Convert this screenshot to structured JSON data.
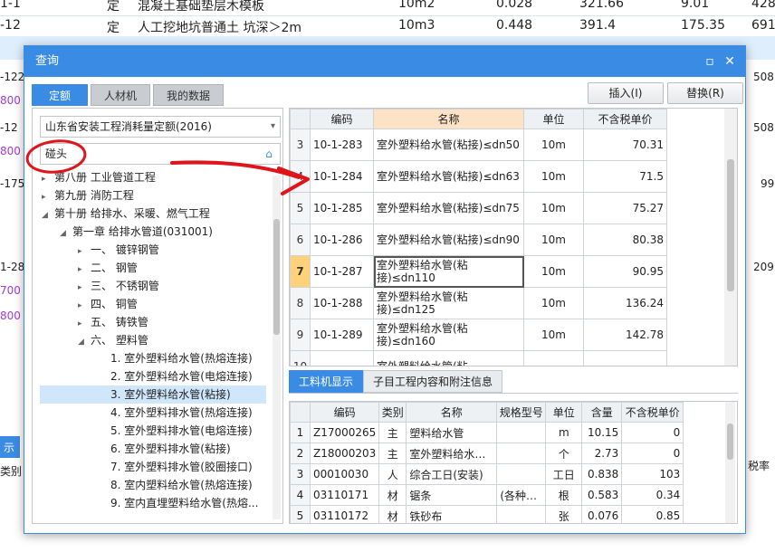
{
  "background": {
    "rows": [
      {
        "c1": "1-1",
        "c2": "定",
        "c3": "混凝土基础垫层木模板",
        "c4": "10m2",
        "c5": "0.028",
        "c6": "321.66",
        "c7": "9.01",
        "c8": "428"
      },
      {
        "c1": "-12",
        "c2": "定",
        "c3": "人工挖地坑普通土 坑深＞2m",
        "c4": "10m3",
        "c5": "0.448",
        "c6": "391.4",
        "c7": "175.35",
        "c8": "691"
      }
    ],
    "side_left": [
      "-122",
      "800",
      "-12",
      "800",
      "-175",
      "1-28",
      "700",
      "800"
    ],
    "side_right": [
      "508",
      "508",
      "99",
      "209"
    ],
    "bottom_left": [
      "示",
      "类别"
    ],
    "bottom_right": "税率"
  },
  "dialog": {
    "title": "查询",
    "tabs": [
      "定额",
      "人材机",
      "我的数据"
    ],
    "insert_button": "插入(I)",
    "replace_button": "替换(R)",
    "library_select": "山东省安装工程消耗量定额(2016)",
    "search_value": "碰头",
    "tree": [
      {
        "label": "第八册 工业管道工程",
        "level": 0,
        "arrow": "▸"
      },
      {
        "label": "第九册 消防工程",
        "level": 0,
        "arrow": "▸"
      },
      {
        "label": "第十册 给排水、采暖、燃气工程",
        "level": 0,
        "arrow": "◢"
      },
      {
        "label": "第一章 给排水管道(031001)",
        "level": 1,
        "arrow": "◢"
      },
      {
        "label": "一、 镀锌钢管",
        "level": 2,
        "arrow": "▸"
      },
      {
        "label": "二、 钢管",
        "level": 2,
        "arrow": "▸"
      },
      {
        "label": "三、 不锈钢管",
        "level": 2,
        "arrow": "▸"
      },
      {
        "label": "四、 铜管",
        "level": 2,
        "arrow": "▸"
      },
      {
        "label": "五、 铸铁管",
        "level": 2,
        "arrow": "▸"
      },
      {
        "label": "六、 塑料管",
        "level": 2,
        "arrow": "◢"
      },
      {
        "label": "1. 室外塑料给水管(热熔连接)",
        "level": 3,
        "arrow": ""
      },
      {
        "label": "2. 室外塑料给水管(电熔连接)",
        "level": 3,
        "arrow": ""
      },
      {
        "label": "3. 室外塑料给水管(粘接)",
        "level": 3,
        "arrow": "",
        "selected": true
      },
      {
        "label": "4. 室外塑料排水管(热熔连接)",
        "level": 3,
        "arrow": ""
      },
      {
        "label": "5. 室外塑料排水管(电熔连接)",
        "level": 3,
        "arrow": ""
      },
      {
        "label": "6. 室外塑料排水管(粘接)",
        "level": 3,
        "arrow": ""
      },
      {
        "label": "7. 室外塑料排水管(胶圈接口)",
        "level": 3,
        "arrow": ""
      },
      {
        "label": "8. 室内塑料给水管(热熔连接)",
        "level": 3,
        "arrow": ""
      },
      {
        "label": "9. 室内直埋塑料给水管(热熔...",
        "level": 3,
        "arrow": ""
      }
    ],
    "grid": {
      "headers": [
        "编码",
        "名称",
        "单位",
        "不含税单价"
      ],
      "rows": [
        {
          "n": "3",
          "code": "10-1-283",
          "name": "室外塑料给水管(粘接)≤dn50",
          "unit": "10m",
          "price": "70.31"
        },
        {
          "n": "4",
          "code": "10-1-284",
          "name": "室外塑料给水管(粘接)≤dn63",
          "unit": "10m",
          "price": "71.5"
        },
        {
          "n": "5",
          "code": "10-1-285",
          "name": "室外塑料给水管(粘接)≤dn75",
          "unit": "10m",
          "price": "75.27"
        },
        {
          "n": "6",
          "code": "10-1-286",
          "name": "室外塑料给水管(粘接)≤dn90",
          "unit": "10m",
          "price": "80.38"
        },
        {
          "n": "7",
          "code": "10-1-287",
          "name": "室外塑料给水管(粘接)≤dn110",
          "unit": "10m",
          "price": "90.95",
          "active": true
        },
        {
          "n": "8",
          "code": "10-1-288",
          "name": "室外塑料给水管(粘接)≤dn125",
          "unit": "10m",
          "price": "136.24"
        },
        {
          "n": "9",
          "code": "10-1-289",
          "name": "室外塑料给水管(粘接)≤dn160",
          "unit": "10m",
          "price": "142.78"
        },
        {
          "n": "10",
          "code": "",
          "name": "室外塑料给水管(粘",
          "unit": "",
          "price": ""
        }
      ]
    },
    "bottom_tabs": [
      "工料机显示",
      "子目工程内容和附注信息"
    ],
    "bottom_grid": {
      "headers": [
        "编码",
        "类别",
        "名称",
        "规格型号",
        "单位",
        "含量",
        "不含税单价"
      ],
      "rows": [
        {
          "n": "1",
          "code": "Z17000265",
          "type": "主",
          "name": "塑料给水管",
          "spec": "",
          "unit": "m",
          "qty": "10.15",
          "price": "0"
        },
        {
          "n": "2",
          "code": "Z18000203",
          "type": "主",
          "name": "室外塑料给水…",
          "spec": "",
          "unit": "个",
          "qty": "2.73",
          "price": "0"
        },
        {
          "n": "3",
          "code": "00010030",
          "type": "人",
          "name": "综合工日(安装)",
          "spec": "",
          "unit": "工日",
          "qty": "0.838",
          "price": "103"
        },
        {
          "n": "4",
          "code": "03110171",
          "type": "材",
          "name": "锯条",
          "spec": "(各种…",
          "unit": "根",
          "qty": "0.583",
          "price": "0.34"
        },
        {
          "n": "5",
          "code": "03110172",
          "type": "材",
          "name": "铁砂布",
          "spec": "",
          "unit": "张",
          "qty": "0.076",
          "price": "0.85"
        }
      ]
    }
  },
  "colors": {
    "accent": "#3a8be3",
    "annotation": "#e0151b",
    "active_row": "#ffd27a"
  }
}
